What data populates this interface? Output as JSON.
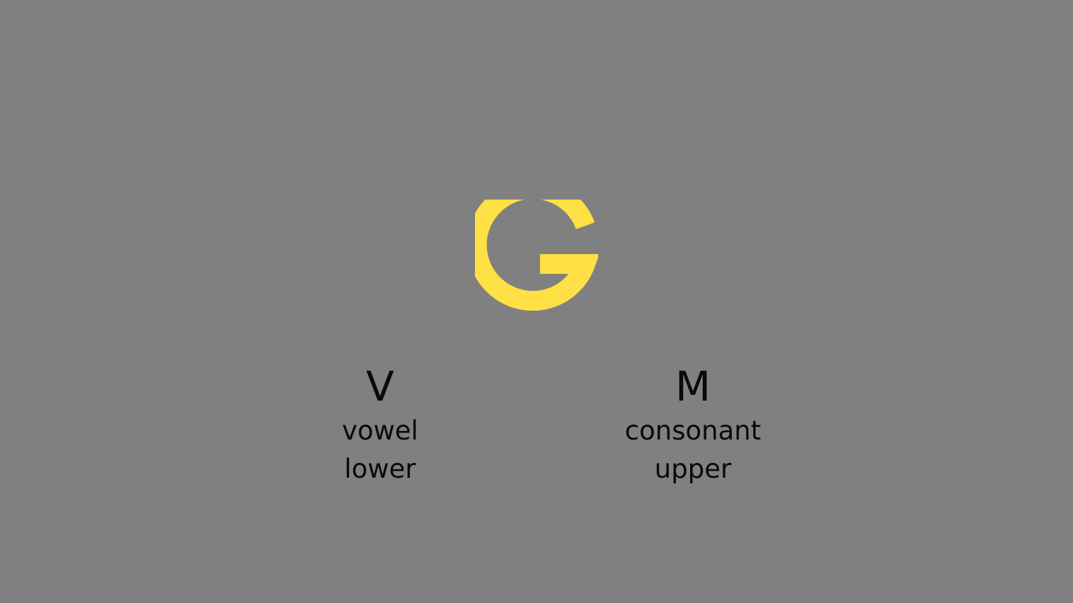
{
  "stimulus": {
    "letter": "G",
    "color": "#FFE045",
    "background": "#808080"
  },
  "options": {
    "left": {
      "key": "V",
      "category": "vowel",
      "case": "lower"
    },
    "right": {
      "key": "M",
      "category": "consonant",
      "case": "upper"
    }
  }
}
